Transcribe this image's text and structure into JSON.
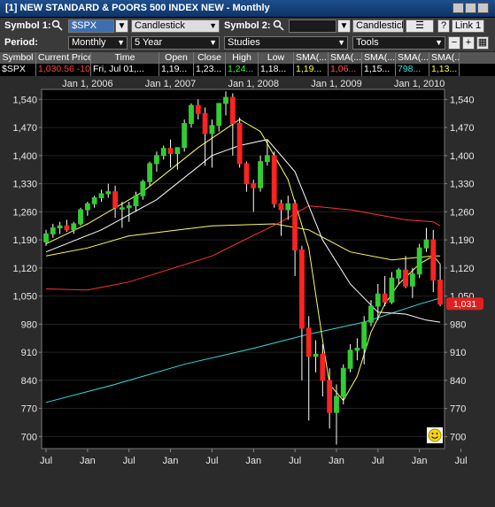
{
  "window": {
    "title": "[1] NEW STANDARD & POORS 500 INDEX NEW - Monthly"
  },
  "toolbar1": {
    "symbol1_label": "Symbol 1:",
    "symbol1_value": "$SPX",
    "chart_type": "Candlestick",
    "symbol2_label": "Symbol 2:",
    "symbol2_value": "",
    "chart_type2": "Candlestick",
    "help_label": "?",
    "link_label": "Link 1"
  },
  "toolbar2": {
    "period_label": "Period:",
    "period_value": "Monthly",
    "range_value": "5 Year",
    "studies_label": "Studies",
    "tools_label": "Tools"
  },
  "quote_table": {
    "headers": [
      "Symbol",
      "Current Price",
      "Time",
      "Open",
      "Close",
      "High",
      "Low",
      "SMA(...",
      "SMA(...",
      "SMA(...",
      "SMA(...",
      "SMA(..."
    ],
    "row": [
      "$SPX",
      "1,030.56  -10...",
      "Fri, Jul 01,...",
      "1,19...",
      "1,23...",
      "1,24...",
      "1,18...",
      "1,19...",
      "1,06...",
      "1,15...",
      "798...",
      "1,13..."
    ],
    "row_colors": [
      "#ffffff",
      "#ff4040",
      "#ffffff",
      "#ffffff",
      "#ffffff",
      "#33ff33",
      "#ffffff",
      "#ffff33",
      "#ff5555",
      "#ffffff",
      "#33e6e6",
      "#ffff33"
    ]
  },
  "chart_data": {
    "type": "candlestick",
    "title": "",
    "x_axis_top": [
      "Jan 1, 2006",
      "Jan 1, 2007",
      "Jan 1, 2008",
      "Jan 1, 2009",
      "Jan 1, 2010"
    ],
    "x_axis_bottom": [
      "Jul",
      "Jan",
      "Jul",
      "Jan",
      "Jul",
      "Jan",
      "Jul",
      "Jan",
      "Jul",
      "Jan",
      "Jul"
    ],
    "y_ticks": [
      700,
      770,
      840,
      910,
      980,
      1050,
      1120,
      1190,
      1260,
      1330,
      1400,
      1470,
      1540
    ],
    "y_tick_labels": [
      "700",
      "770",
      "840",
      "910",
      "980",
      "1,050",
      "1,120",
      "1,190",
      "1,260",
      "1,330",
      "1,400",
      "1,470",
      "1,540"
    ],
    "ylim": [
      670,
      1565
    ],
    "last_price_label": "1,031",
    "candles": [
      {
        "o": 1185,
        "h": 1215,
        "l": 1175,
        "c": 1205
      },
      {
        "o": 1205,
        "h": 1230,
        "l": 1195,
        "c": 1220
      },
      {
        "o": 1220,
        "h": 1235,
        "l": 1205,
        "c": 1225
      },
      {
        "o": 1225,
        "h": 1240,
        "l": 1210,
        "c": 1215
      },
      {
        "o": 1215,
        "h": 1235,
        "l": 1205,
        "c": 1230
      },
      {
        "o": 1230,
        "h": 1270,
        "l": 1225,
        "c": 1265
      },
      {
        "o": 1265,
        "h": 1285,
        "l": 1250,
        "c": 1280
      },
      {
        "o": 1280,
        "h": 1300,
        "l": 1270,
        "c": 1295
      },
      {
        "o": 1295,
        "h": 1315,
        "l": 1285,
        "c": 1305
      },
      {
        "o": 1305,
        "h": 1330,
        "l": 1295,
        "c": 1310
      },
      {
        "o": 1310,
        "h": 1325,
        "l": 1245,
        "c": 1270
      },
      {
        "o": 1270,
        "h": 1285,
        "l": 1220,
        "c": 1270
      },
      {
        "o": 1270,
        "h": 1285,
        "l": 1235,
        "c": 1275
      },
      {
        "o": 1275,
        "h": 1310,
        "l": 1260,
        "c": 1300
      },
      {
        "o": 1300,
        "h": 1340,
        "l": 1290,
        "c": 1335
      },
      {
        "o": 1335,
        "h": 1385,
        "l": 1325,
        "c": 1380
      },
      {
        "o": 1380,
        "h": 1410,
        "l": 1360,
        "c": 1400
      },
      {
        "o": 1400,
        "h": 1425,
        "l": 1390,
        "c": 1418
      },
      {
        "o": 1418,
        "h": 1440,
        "l": 1370,
        "c": 1405
      },
      {
        "o": 1405,
        "h": 1415,
        "l": 1365,
        "c": 1420
      },
      {
        "o": 1420,
        "h": 1490,
        "l": 1410,
        "c": 1480
      },
      {
        "o": 1480,
        "h": 1530,
        "l": 1470,
        "c": 1525
      },
      {
        "o": 1525,
        "h": 1540,
        "l": 1490,
        "c": 1505
      },
      {
        "o": 1505,
        "h": 1520,
        "l": 1375,
        "c": 1455
      },
      {
        "o": 1455,
        "h": 1490,
        "l": 1370,
        "c": 1475
      },
      {
        "o": 1475,
        "h": 1520,
        "l": 1460,
        "c": 1530
      },
      {
        "o": 1530,
        "h": 1560,
        "l": 1500,
        "c": 1545
      },
      {
        "o": 1545,
        "h": 1555,
        "l": 1400,
        "c": 1480
      },
      {
        "o": 1480,
        "h": 1495,
        "l": 1370,
        "c": 1380
      },
      {
        "o": 1380,
        "h": 1385,
        "l": 1310,
        "c": 1330
      },
      {
        "o": 1330,
        "h": 1340,
        "l": 1260,
        "c": 1320
      },
      {
        "o": 1320,
        "h": 1400,
        "l": 1310,
        "c": 1385
      },
      {
        "o": 1385,
        "h": 1440,
        "l": 1375,
        "c": 1400
      },
      {
        "o": 1400,
        "h": 1410,
        "l": 1270,
        "c": 1280
      },
      {
        "o": 1280,
        "h": 1290,
        "l": 1200,
        "c": 1265
      },
      {
        "o": 1265,
        "h": 1300,
        "l": 1240,
        "c": 1280
      },
      {
        "o": 1280,
        "h": 1290,
        "l": 1100,
        "c": 1165
      },
      {
        "o": 1165,
        "h": 1175,
        "l": 840,
        "c": 970
      },
      {
        "o": 970,
        "h": 1000,
        "l": 740,
        "c": 900
      },
      {
        "o": 900,
        "h": 940,
        "l": 860,
        "c": 905
      },
      {
        "o": 905,
        "h": 930,
        "l": 800,
        "c": 840
      },
      {
        "o": 840,
        "h": 870,
        "l": 720,
        "c": 760
      },
      {
        "o": 760,
        "h": 830,
        "l": 680,
        "c": 800
      },
      {
        "o": 800,
        "h": 880,
        "l": 780,
        "c": 870
      },
      {
        "o": 870,
        "h": 930,
        "l": 860,
        "c": 915
      },
      {
        "o": 915,
        "h": 945,
        "l": 890,
        "c": 920
      },
      {
        "o": 920,
        "h": 1000,
        "l": 880,
        "c": 985
      },
      {
        "o": 985,
        "h": 1040,
        "l": 975,
        "c": 1025
      },
      {
        "o": 1025,
        "h": 1080,
        "l": 990,
        "c": 1055
      },
      {
        "o": 1055,
        "h": 1100,
        "l": 1025,
        "c": 1035
      },
      {
        "o": 1035,
        "h": 1110,
        "l": 1030,
        "c": 1095
      },
      {
        "o": 1095,
        "h": 1120,
        "l": 1080,
        "c": 1115
      },
      {
        "o": 1115,
        "h": 1150,
        "l": 1070,
        "c": 1075
      },
      {
        "o": 1075,
        "h": 1120,
        "l": 1045,
        "c": 1105
      },
      {
        "o": 1105,
        "h": 1180,
        "l": 1095,
        "c": 1170
      },
      {
        "o": 1170,
        "h": 1220,
        "l": 1160,
        "c": 1190
      },
      {
        "o": 1190,
        "h": 1215,
        "l": 1060,
        "c": 1090
      },
      {
        "o": 1090,
        "h": 1130,
        "l": 1025,
        "c": 1030
      }
    ],
    "overlays": [
      {
        "color": "#ffff55",
        "points": [
          [
            0,
            1150
          ],
          [
            6,
            1170
          ],
          [
            12,
            1200
          ],
          [
            24,
            1225
          ],
          [
            33,
            1230
          ],
          [
            38,
            1215
          ],
          [
            44,
            1160
          ],
          [
            50,
            1140
          ],
          [
            56,
            1150
          ],
          [
            57,
            1150
          ]
        ]
      },
      {
        "color": "#ff3333",
        "points": [
          [
            0,
            1068
          ],
          [
            6,
            1065
          ],
          [
            12,
            1085
          ],
          [
            24,
            1150
          ],
          [
            34,
            1235
          ],
          [
            38,
            1275
          ],
          [
            44,
            1265
          ],
          [
            52,
            1240
          ],
          [
            56,
            1235
          ],
          [
            57,
            1225
          ]
        ]
      },
      {
        "color": "#33dddd",
        "points": [
          [
            0,
            785
          ],
          [
            10,
            830
          ],
          [
            20,
            880
          ],
          [
            30,
            920
          ],
          [
            38,
            955
          ],
          [
            46,
            985
          ],
          [
            54,
            1030
          ],
          [
            57,
            1045
          ]
        ]
      },
      {
        "color": "#ffffff",
        "points": [
          [
            0,
            1160
          ],
          [
            8,
            1215
          ],
          [
            16,
            1290
          ],
          [
            24,
            1400
          ],
          [
            28,
            1425
          ],
          [
            32,
            1440
          ],
          [
            36,
            1360
          ],
          [
            40,
            1190
          ],
          [
            44,
            1080
          ],
          [
            48,
            1010
          ],
          [
            52,
            1005
          ],
          [
            55,
            990
          ],
          [
            57,
            985
          ]
        ]
      },
      {
        "color": "#ffff55",
        "points": [
          [
            0,
            1180
          ],
          [
            6,
            1230
          ],
          [
            14,
            1310
          ],
          [
            22,
            1420
          ],
          [
            28,
            1490
          ],
          [
            31,
            1460
          ],
          [
            35,
            1340
          ],
          [
            38,
            1170
          ],
          [
            40,
            940
          ],
          [
            41,
            830
          ],
          [
            43,
            790
          ],
          [
            45,
            850
          ],
          [
            47,
            960
          ],
          [
            49,
            1030
          ],
          [
            51,
            1080
          ],
          [
            54,
            1130
          ],
          [
            56,
            1150
          ],
          [
            57,
            1130
          ]
        ]
      }
    ]
  },
  "icons": {
    "search": "search-icon",
    "list": "list-icon",
    "smiley": "smiley-icon"
  }
}
